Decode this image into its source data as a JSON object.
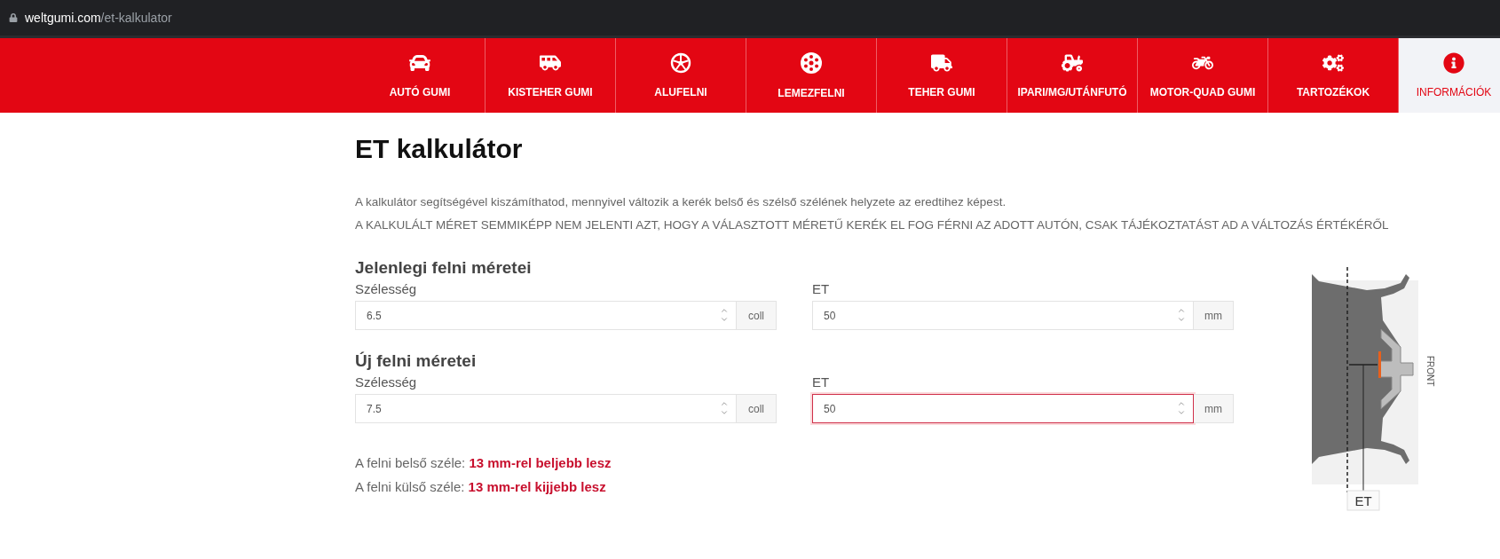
{
  "browser": {
    "domain": "weltgumi.com",
    "path": "/et-kalkulator"
  },
  "nav": [
    {
      "label": "AUTÓ GUMI",
      "selected": false
    },
    {
      "label": "KISTEHER GUMI",
      "selected": false
    },
    {
      "label": "ALUFELNI",
      "selected": false
    },
    {
      "label": "LEMEZFELNI",
      "selected": false
    },
    {
      "label": "TEHER GUMI",
      "selected": false
    },
    {
      "label": "IPARI/MG/UTÁNFUTÓ",
      "selected": false
    },
    {
      "label": "MOTOR-QUAD GUMI",
      "selected": false
    },
    {
      "label": "TARTOZÉKOK",
      "selected": false
    },
    {
      "label": "INFORMÁCIÓK",
      "selected": true
    }
  ],
  "page": {
    "title": "ET kalkulátor",
    "intro": [
      "A kalkulátor segítségével kiszámíthatod, mennyivel változik a kerék belső és szélső szélének helyzete az eredtihez képest.",
      "A KALKULÁLT MÉRET SEMMIKÉPP NEM JELENTI AZT, HOGY A VÁLASZTOTT MÉRETŰ KERÉK EL FOG FÉRNI AZ ADOTT AUTÓN, CSAK TÁJÉKOZTATÁST AD A VÁLTOZÁS ÉRTÉKÉRŐL"
    ]
  },
  "sections": [
    {
      "heading": "Jelenlegi felni méretei",
      "fields": [
        {
          "label": "Szélesség",
          "value": "6.5",
          "unit": "coll",
          "focused": false
        },
        {
          "label": "ET",
          "value": "50",
          "unit": "mm",
          "focused": false
        }
      ]
    },
    {
      "heading": "Új felni méretei",
      "fields": [
        {
          "label": "Szélesség",
          "value": "7.5",
          "unit": "coll",
          "focused": false
        },
        {
          "label": "ET",
          "value": "50",
          "unit": "mm",
          "focused": true
        }
      ]
    }
  ],
  "results": [
    "A felni belső széle: **13 mm-rel beljebb lesz**",
    "A felni külső széle: **13 mm-rel kijjebb lesz**"
  ],
  "diagram": {
    "side_label": "FRONT",
    "offset_label": "ET"
  }
}
